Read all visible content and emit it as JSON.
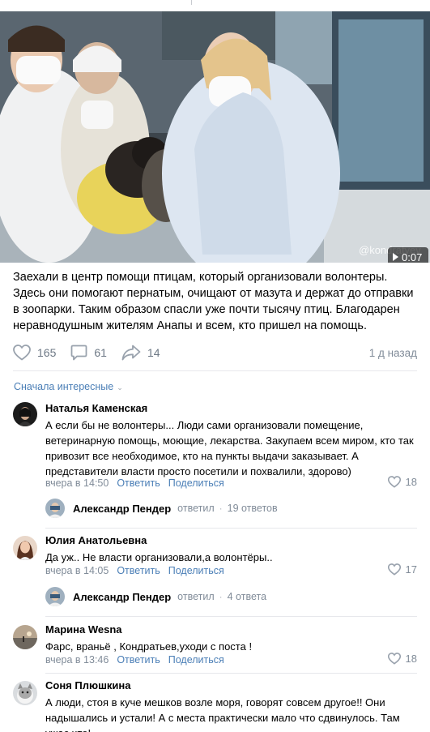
{
  "video": {
    "watermark": "@kondratyev",
    "duration": "0:07",
    "play_icon": "play-icon"
  },
  "post": {
    "text": "Заехали в центр помощи птицам, который организовали волонтеры. Здесь они помогают пернатым, очищают от мазута и держат до отправки в зоопарки. Таким образом спасли уже почти тысячу птиц. Благодарен неравнодушным жителям Анапы и всем, кто пришел на помощь.",
    "likes": "165",
    "comments": "61",
    "shares": "14",
    "date": "1 д назад",
    "icons": {
      "like": "heart-icon",
      "comment": "comment-icon",
      "share": "share-icon"
    }
  },
  "comments_section": {
    "sort_label": "Сначала интересные",
    "sort_icon": "chevron-down-icon",
    "reply_label": "Ответить",
    "share_label": "Поделиться",
    "comments": [
      {
        "author": "Наталья Каменская",
        "text": "А если бы не волонтеры... Люди сами организовали помещение, ветеринарную помощь, моющие, лекарства. Закупаем всем миром, кто так привозит все необходимое, кто на пункты выдачи заказывает. А представители власти просто посетили и похвалили, здорово)",
        "time": "вчера в 14:50",
        "likes": "18",
        "reply": {
          "author": "Александр Пендер",
          "verb": "ответил",
          "count": "19 ответов"
        }
      },
      {
        "author": "Юлия Анатольевна",
        "text": "Да уж.. Не власти организовали,а волонтёры..",
        "time": "вчера в 14:05",
        "likes": "17",
        "reply": {
          "author": "Александр Пендер",
          "verb": "ответил",
          "count": "4 ответа"
        }
      },
      {
        "author": "Марина Wesna",
        "text": "Фарс, враньё , Кондратьев,уходи с поста !",
        "time": "вчера в 13:46",
        "likes": "18"
      },
      {
        "author": "Соня Плюшкина",
        "text": "А люди, стоя в куче мешков возле моря, говорят совсем другое!! Они надышались и устали! А с места практически мало что сдвинулось. Там ужас что!"
      }
    ]
  },
  "colors": {
    "link": "#4a7eb6",
    "secondary": "#818c99",
    "icon": "#99a2ad",
    "divider": "#e7e8ec"
  }
}
